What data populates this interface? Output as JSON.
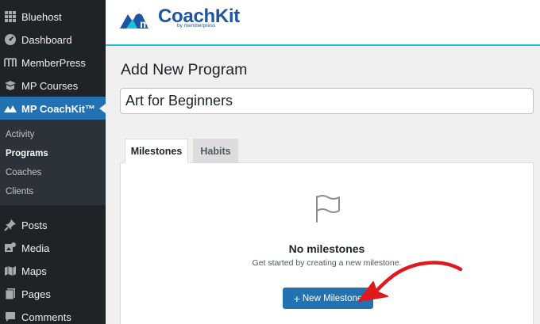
{
  "sidebar": {
    "items": [
      {
        "label": "Bluehost",
        "icon": "grid-icon"
      },
      {
        "label": "Dashboard",
        "icon": "dashboard-icon"
      },
      {
        "label": "MemberPress",
        "icon": "memberpress-icon"
      },
      {
        "label": "MP Courses",
        "icon": "courses-icon"
      },
      {
        "label": "MP CoachKit™",
        "icon": "coachkit-icon",
        "active": true
      },
      {
        "label": "Posts",
        "icon": "pin-icon"
      },
      {
        "label": "Media",
        "icon": "media-icon"
      },
      {
        "label": "Maps",
        "icon": "map-icon"
      },
      {
        "label": "Pages",
        "icon": "pages-icon"
      },
      {
        "label": "Comments",
        "icon": "comments-icon"
      }
    ],
    "submenu": [
      {
        "label": "Activity"
      },
      {
        "label": "Programs",
        "current": true
      },
      {
        "label": "Coaches"
      },
      {
        "label": "Clients"
      }
    ]
  },
  "header": {
    "logo_text": "CoachKit",
    "logo_subtext": "by memberpress",
    "accent_color": "#19c3d5"
  },
  "main": {
    "page_title": "Add New Program",
    "program_title_value": "Art for Beginners",
    "tabs": [
      {
        "label": "Milestones",
        "active": true
      },
      {
        "label": "Habits",
        "active": false
      }
    ],
    "empty_state": {
      "icon": "flag-icon",
      "title": "No milestones",
      "subtitle": "Get started by creating a new milestone.",
      "button_label": "New Milestone",
      "button_icon": "plus-icon"
    }
  },
  "annotation": {
    "icon": "red-arrow-icon",
    "color": "#e0191e"
  }
}
